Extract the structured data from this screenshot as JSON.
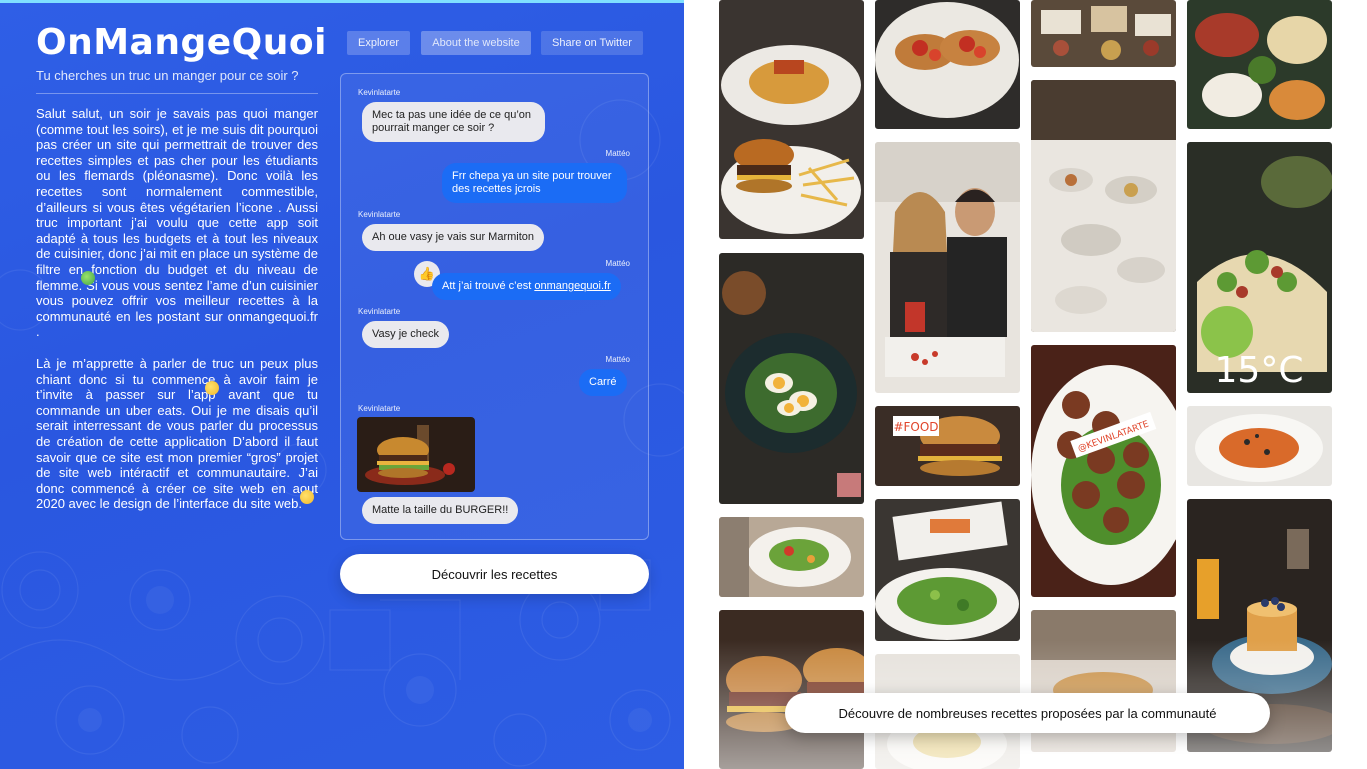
{
  "brand": {
    "logo": "OnMangeQuoi",
    "tagline": "Tu cherches un truc un manger pour ce soir ?"
  },
  "nav": {
    "explorer": "Explorer",
    "about": "About the website",
    "share": "Share on Twitter"
  },
  "intro": {
    "paragraph1": "Salut salut, un soir je savais pas quoi manger (comme tout les soirs), et je me suis dit pourquoi pas créer un site qui permettrait de trouver des recettes simples et pas cher pour les étudiants ou les flemards (pléonasme). Donc voilà les recettes sont normalement commestible, d’ailleurs si vous êtes végétarien l’icone      . Aussi truc important j’ai voulu que cette app soit adapté à tous les budgets et à tout les niveaux de cuisinier, donc j’ai mit en place un système de filtre en fonction du budget et du niveau de flemme. Si vous vous sentez l’ame d’un cuisinier vous pouvez offrir vos meilleur recettes à la communauté en les postant sur onmangequoi.fr     .",
    "paragraph2": "Là je m’apprette à parler de truc un peux plus chiant donc si tu commence à avoir faim je t’invite à passer sur l’app avant que tu commande un uber eats. Oui je me disais qu’il serait interressant de vous parler du processus de création de cette application D’abord il faut savoir que ce site est mon premier “gros” projet de site web intéractif et communautaire. J’ai donc commencé à créer ce site web en aout 2020 avec le design de l’interface du site web."
  },
  "chat": {
    "messages": [
      {
        "sender": "Kevinlatarte",
        "text": "Mec ta pas une idée de ce qu’on pourrait manger ce soir ?"
      },
      {
        "sender": "Mattéo",
        "text": "Frr chepa ya un site pour trouver des recettes jcrois"
      },
      {
        "sender": "Kevinlatarte",
        "text": "Ah oue vasy je vais sur Marmiton"
      },
      {
        "sender": "Mattéo",
        "text_prefix": "Att j’ai trouvé c’est ",
        "link": "onmangequoi.fr"
      },
      {
        "sender": "Kevinlatarte",
        "text": "Vasy je check"
      },
      {
        "sender": "Mattéo",
        "text": "Carré"
      },
      {
        "sender": "Kevinlatarte",
        "text": "Matte la taille du BURGER!!"
      }
    ],
    "like_icon": "thumbs-up-icon"
  },
  "cta": {
    "discover": "Découvrir les recettes"
  },
  "gallery": {
    "overlays": {
      "food_tag": "#FOOD",
      "user_tag": "@KEVINLATARTE",
      "temperature": "15°C"
    },
    "community_button": "Découvre de nombreuses recettes proposées par la communauté"
  },
  "colors": {
    "left_bg": "#2b59e2",
    "bubble_out": "#1b6cf5",
    "bubble_in": "#e9e9ee"
  }
}
